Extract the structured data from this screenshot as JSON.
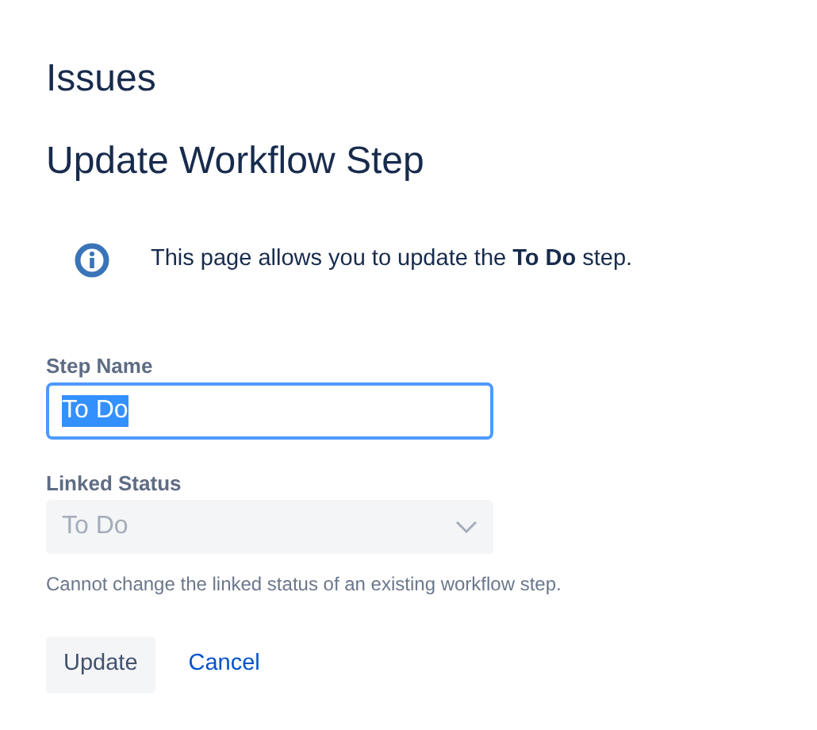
{
  "breadcrumb": "Issues",
  "heading": "Update Workflow Step",
  "info": {
    "text": "This page allows you to update the **To Do** step."
  },
  "fields": [
    {
      "kind": "text",
      "label": "Step Name",
      "value": "To Do",
      "focused": true,
      "highlighted": true
    },
    {
      "kind": "select",
      "label": "Linked Status",
      "value": "To Do",
      "disabled": true,
      "help": "Cannot change the linked status of an existing workflow step."
    }
  ],
  "buttons": [
    {
      "kind": "button",
      "label": "Update"
    },
    {
      "kind": "link",
      "label": "Cancel"
    }
  ]
}
